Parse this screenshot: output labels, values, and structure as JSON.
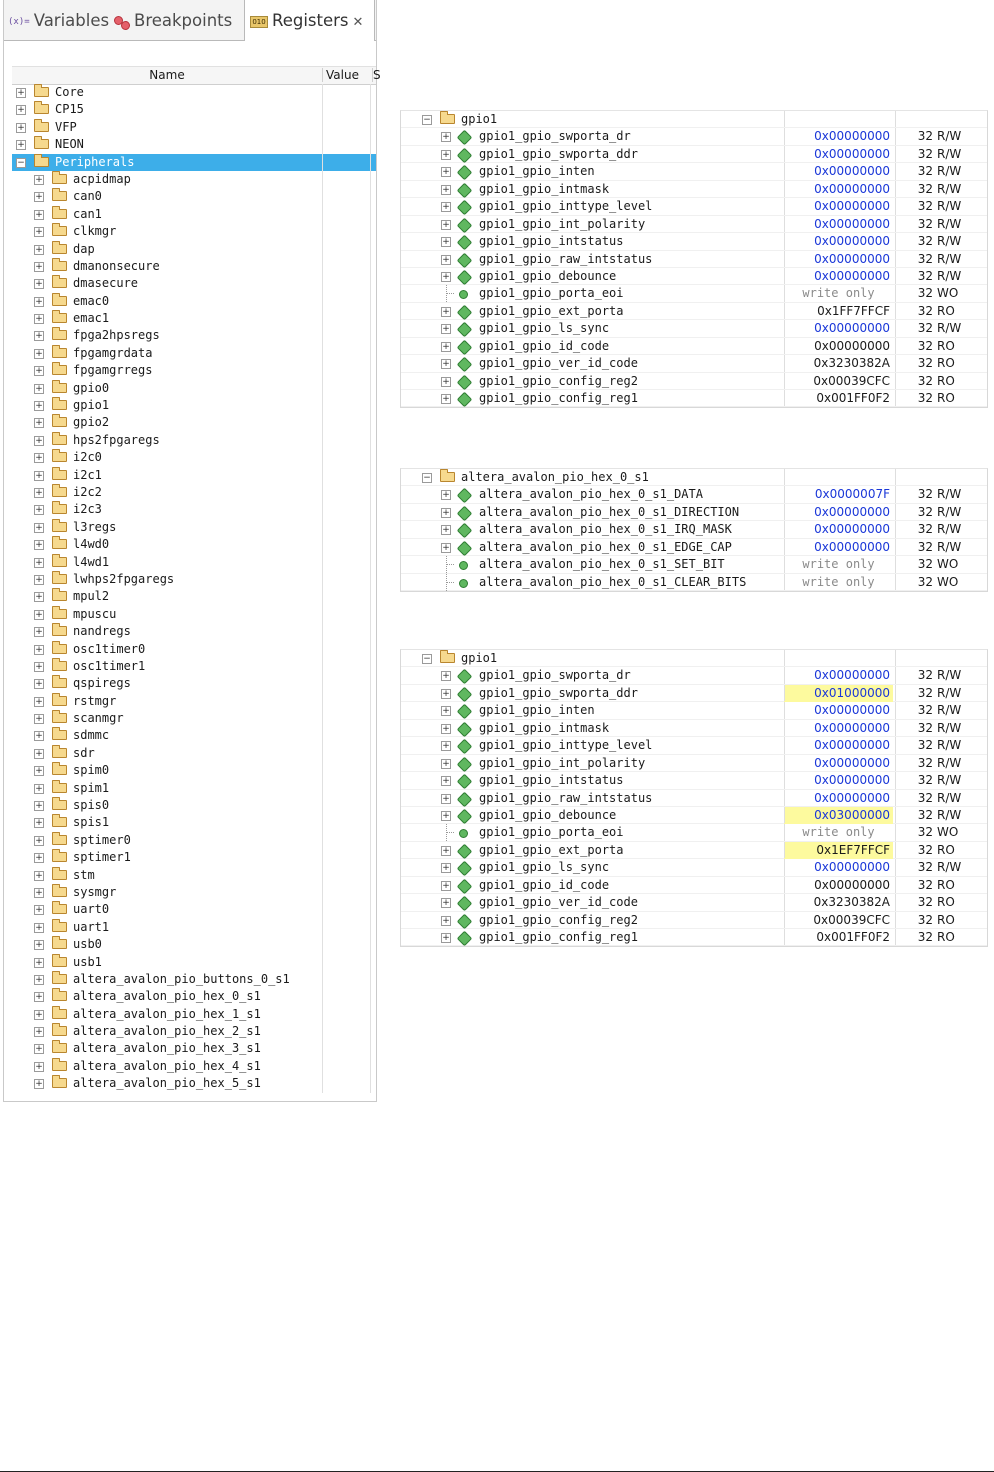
{
  "tabs": [
    {
      "label": "Variables",
      "icon": "variables-icon"
    },
    {
      "label": "Breakpoints",
      "icon": "breakpoints-icon"
    },
    {
      "label": "Registers",
      "icon": "registers-icon",
      "active": true,
      "close": "✕"
    }
  ],
  "tab_icons": {
    "variables": "(x)=",
    "registers": "010"
  },
  "columns": {
    "name": "Name",
    "value": "Value",
    "s": "S"
  },
  "tree": [
    {
      "label": "Core",
      "level": 0
    },
    {
      "label": "CP15",
      "level": 0
    },
    {
      "label": "VFP",
      "level": 0
    },
    {
      "label": "NEON",
      "level": 0
    },
    {
      "label": "Peripherals",
      "level": 0,
      "expanded": true,
      "selected": true
    },
    {
      "label": "acpidmap",
      "level": 1
    },
    {
      "label": "can0",
      "level": 1
    },
    {
      "label": "can1",
      "level": 1
    },
    {
      "label": "clkmgr",
      "level": 1
    },
    {
      "label": "dap",
      "level": 1
    },
    {
      "label": "dmanonsecure",
      "level": 1
    },
    {
      "label": "dmasecure",
      "level": 1
    },
    {
      "label": "emac0",
      "level": 1
    },
    {
      "label": "emac1",
      "level": 1
    },
    {
      "label": "fpga2hpsregs",
      "level": 1
    },
    {
      "label": "fpgamgrdata",
      "level": 1
    },
    {
      "label": "fpgamgrregs",
      "level": 1
    },
    {
      "label": "gpio0",
      "level": 1
    },
    {
      "label": "gpio1",
      "level": 1
    },
    {
      "label": "gpio2",
      "level": 1
    },
    {
      "label": "hps2fpgaregs",
      "level": 1
    },
    {
      "label": "i2c0",
      "level": 1
    },
    {
      "label": "i2c1",
      "level": 1
    },
    {
      "label": "i2c2",
      "level": 1
    },
    {
      "label": "i2c3",
      "level": 1
    },
    {
      "label": "l3regs",
      "level": 1
    },
    {
      "label": "l4wd0",
      "level": 1
    },
    {
      "label": "l4wd1",
      "level": 1
    },
    {
      "label": "lwhps2fpgaregs",
      "level": 1
    },
    {
      "label": "mpul2",
      "level": 1
    },
    {
      "label": "mpuscu",
      "level": 1
    },
    {
      "label": "nandregs",
      "level": 1
    },
    {
      "label": "osc1timer0",
      "level": 1
    },
    {
      "label": "osc1timer1",
      "level": 1
    },
    {
      "label": "qspiregs",
      "level": 1
    },
    {
      "label": "rstmgr",
      "level": 1
    },
    {
      "label": "scanmgr",
      "level": 1
    },
    {
      "label": "sdmmc",
      "level": 1
    },
    {
      "label": "sdr",
      "level": 1
    },
    {
      "label": "spim0",
      "level": 1
    },
    {
      "label": "spim1",
      "level": 1
    },
    {
      "label": "spis0",
      "level": 1
    },
    {
      "label": "spis1",
      "level": 1
    },
    {
      "label": "sptimer0",
      "level": 1
    },
    {
      "label": "sptimer1",
      "level": 1
    },
    {
      "label": "stm",
      "level": 1
    },
    {
      "label": "sysmgr",
      "level": 1
    },
    {
      "label": "uart0",
      "level": 1
    },
    {
      "label": "uart1",
      "level": 1
    },
    {
      "label": "usb0",
      "level": 1
    },
    {
      "label": "usb1",
      "level": 1
    },
    {
      "label": "altera_avalon_pio_buttons_0_s1",
      "level": 1
    },
    {
      "label": "altera_avalon_pio_hex_0_s1",
      "level": 1
    },
    {
      "label": "altera_avalon_pio_hex_1_s1",
      "level": 1
    },
    {
      "label": "altera_avalon_pio_hex_2_s1",
      "level": 1
    },
    {
      "label": "altera_avalon_pio_hex_3_s1",
      "level": 1
    },
    {
      "label": "altera_avalon_pio_hex_4_s1",
      "level": 1
    },
    {
      "label": "altera_avalon_pio_hex_5_s1",
      "level": 1
    }
  ],
  "panels": [
    {
      "group": "gpio1",
      "rows": [
        {
          "name": "gpio1_gpio_swporta_dr",
          "value": "0x00000000",
          "size": "32",
          "access": "R/W",
          "style": "blue",
          "kind": "reg"
        },
        {
          "name": "gpio1_gpio_swporta_ddr",
          "value": "0x00000000",
          "size": "32",
          "access": "R/W",
          "style": "blue",
          "kind": "reg"
        },
        {
          "name": "gpio1_gpio_inten",
          "value": "0x00000000",
          "size": "32",
          "access": "R/W",
          "style": "blue",
          "kind": "reg"
        },
        {
          "name": "gpio1_gpio_intmask",
          "value": "0x00000000",
          "size": "32",
          "access": "R/W",
          "style": "blue",
          "kind": "reg"
        },
        {
          "name": "gpio1_gpio_inttype_level",
          "value": "0x00000000",
          "size": "32",
          "access": "R/W",
          "style": "blue",
          "kind": "reg"
        },
        {
          "name": "gpio1_gpio_int_polarity",
          "value": "0x00000000",
          "size": "32",
          "access": "R/W",
          "style": "blue",
          "kind": "reg"
        },
        {
          "name": "gpio1_gpio_intstatus",
          "value": "0x00000000",
          "size": "32",
          "access": "R/W",
          "style": "blue",
          "kind": "reg"
        },
        {
          "name": "gpio1_gpio_raw_intstatus",
          "value": "0x00000000",
          "size": "32",
          "access": "R/W",
          "style": "blue",
          "kind": "reg"
        },
        {
          "name": "gpio1_gpio_debounce",
          "value": "0x00000000",
          "size": "32",
          "access": "R/W",
          "style": "blue",
          "kind": "reg"
        },
        {
          "name": "gpio1_gpio_porta_eoi",
          "value": "write only",
          "size": "32",
          "access": "WO",
          "style": "wo",
          "kind": "field"
        },
        {
          "name": "gpio1_gpio_ext_porta",
          "value": "0x1FF7FFCF",
          "size": "32",
          "access": "RO",
          "style": "gray",
          "kind": "reg"
        },
        {
          "name": "gpio1_gpio_ls_sync",
          "value": "0x00000000",
          "size": "32",
          "access": "R/W",
          "style": "blue",
          "kind": "reg"
        },
        {
          "name": "gpio1_gpio_id_code",
          "value": "0x00000000",
          "size": "32",
          "access": "RO",
          "style": "gray",
          "kind": "reg"
        },
        {
          "name": "gpio1_gpio_ver_id_code",
          "value": "0x3230382A",
          "size": "32",
          "access": "RO",
          "style": "gray",
          "kind": "reg"
        },
        {
          "name": "gpio1_gpio_config_reg2",
          "value": "0x00039CFC",
          "size": "32",
          "access": "RO",
          "style": "gray",
          "kind": "reg"
        },
        {
          "name": "gpio1_gpio_config_reg1",
          "value": "0x001FF0F2",
          "size": "32",
          "access": "RO",
          "style": "gray",
          "kind": "reg"
        }
      ]
    },
    {
      "group": "altera_avalon_pio_hex_0_s1",
      "rows": [
        {
          "name": "altera_avalon_pio_hex_0_s1_DATA",
          "value": "0x0000007F",
          "size": "32",
          "access": "R/W",
          "style": "blue",
          "kind": "reg"
        },
        {
          "name": "altera_avalon_pio_hex_0_s1_DIRECTION",
          "value": "0x00000000",
          "size": "32",
          "access": "R/W",
          "style": "blue",
          "kind": "reg"
        },
        {
          "name": "altera_avalon_pio_hex_0_s1_IRQ_MASK",
          "value": "0x00000000",
          "size": "32",
          "access": "R/W",
          "style": "blue",
          "kind": "reg"
        },
        {
          "name": "altera_avalon_pio_hex_0_s1_EDGE_CAP",
          "value": "0x00000000",
          "size": "32",
          "access": "R/W",
          "style": "blue",
          "kind": "reg"
        },
        {
          "name": "altera_avalon_pio_hex_0_s1_SET_BIT",
          "value": "write only",
          "size": "32",
          "access": "WO",
          "style": "wo",
          "kind": "field"
        },
        {
          "name": "altera_avalon_pio_hex_0_s1_CLEAR_BITS",
          "value": "write only",
          "size": "32",
          "access": "WO",
          "style": "wo",
          "kind": "field"
        }
      ]
    },
    {
      "group": "gpio1",
      "rows": [
        {
          "name": "gpio1_gpio_swporta_dr",
          "value": "0x00000000",
          "size": "32",
          "access": "R/W",
          "style": "blue",
          "kind": "reg"
        },
        {
          "name": "gpio1_gpio_swporta_ddr",
          "value": "0x01000000",
          "size": "32",
          "access": "R/W",
          "style": "blue",
          "highlight": true,
          "kind": "reg"
        },
        {
          "name": "gpio1_gpio_inten",
          "value": "0x00000000",
          "size": "32",
          "access": "R/W",
          "style": "blue",
          "kind": "reg"
        },
        {
          "name": "gpio1_gpio_intmask",
          "value": "0x00000000",
          "size": "32",
          "access": "R/W",
          "style": "blue",
          "kind": "reg"
        },
        {
          "name": "gpio1_gpio_inttype_level",
          "value": "0x00000000",
          "size": "32",
          "access": "R/W",
          "style": "blue",
          "kind": "reg"
        },
        {
          "name": "gpio1_gpio_int_polarity",
          "value": "0x00000000",
          "size": "32",
          "access": "R/W",
          "style": "blue",
          "kind": "reg"
        },
        {
          "name": "gpio1_gpio_intstatus",
          "value": "0x00000000",
          "size": "32",
          "access": "R/W",
          "style": "blue",
          "kind": "reg"
        },
        {
          "name": "gpio1_gpio_raw_intstatus",
          "value": "0x00000000",
          "size": "32",
          "access": "R/W",
          "style": "blue",
          "kind": "reg"
        },
        {
          "name": "gpio1_gpio_debounce",
          "value": "0x03000000",
          "size": "32",
          "access": "R/W",
          "style": "blue",
          "highlight": true,
          "kind": "reg"
        },
        {
          "name": "gpio1_gpio_porta_eoi",
          "value": "write only",
          "size": "32",
          "access": "WO",
          "style": "wo",
          "kind": "field"
        },
        {
          "name": "gpio1_gpio_ext_porta",
          "value": "0x1EF7FFCF",
          "size": "32",
          "access": "RO",
          "style": "gray",
          "highlight": true,
          "kind": "reg"
        },
        {
          "name": "gpio1_gpio_ls_sync",
          "value": "0x00000000",
          "size": "32",
          "access": "R/W",
          "style": "blue",
          "kind": "reg"
        },
        {
          "name": "gpio1_gpio_id_code",
          "value": "0x00000000",
          "size": "32",
          "access": "RO",
          "style": "gray",
          "kind": "reg"
        },
        {
          "name": "gpio1_gpio_ver_id_code",
          "value": "0x3230382A",
          "size": "32",
          "access": "RO",
          "style": "gray",
          "kind": "reg"
        },
        {
          "name": "gpio1_gpio_config_reg2",
          "value": "0x00039CFC",
          "size": "32",
          "access": "RO",
          "style": "gray",
          "kind": "reg"
        },
        {
          "name": "gpio1_gpio_config_reg1",
          "value": "0x001FF0F2",
          "size": "32",
          "access": "RO",
          "style": "gray",
          "kind": "reg"
        }
      ]
    }
  ],
  "colors": {
    "selection": "#3daee9",
    "value_blue": "#1a37d8",
    "changed_highlight": "#fdfa9e"
  }
}
